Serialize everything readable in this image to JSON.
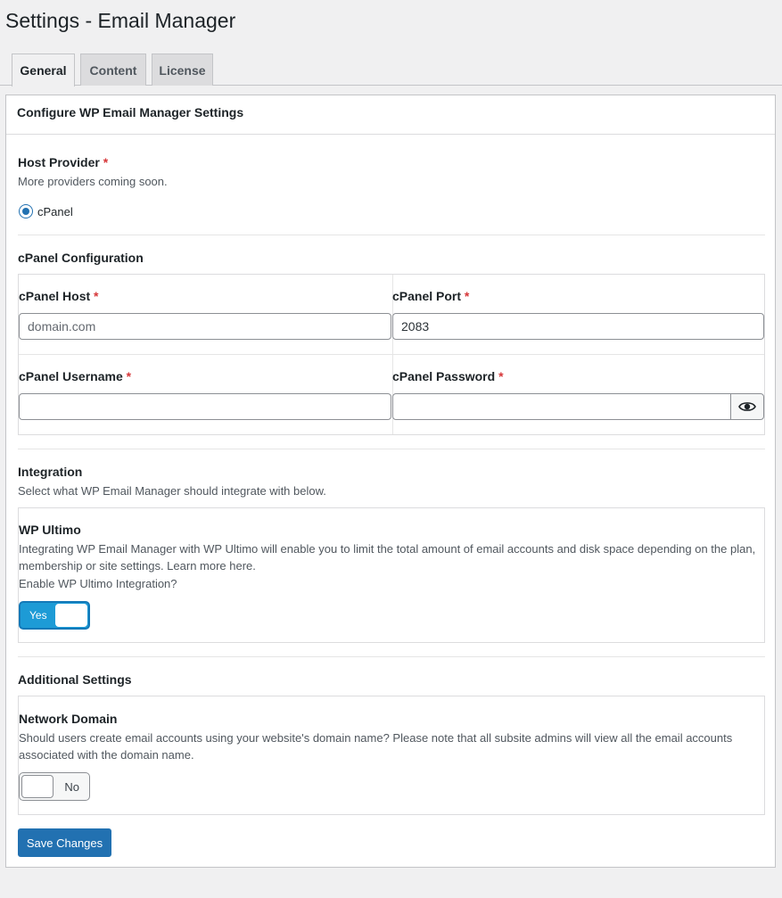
{
  "page": {
    "title": "Settings - Email Manager"
  },
  "tabs": [
    {
      "label": "General",
      "active": true
    },
    {
      "label": "Content",
      "active": false
    },
    {
      "label": "License",
      "active": false
    }
  ],
  "panel": {
    "heading": "Configure WP Email Manager Settings",
    "host_provider": {
      "label": "Host Provider",
      "required_mark": "*",
      "description": "More providers coming soon.",
      "option_label": "cPanel",
      "selected": true
    },
    "cpanel_config": {
      "heading": "cPanel Configuration",
      "host": {
        "label": "cPanel Host",
        "required_mark": "*",
        "placeholder": "domain.com",
        "value": ""
      },
      "port": {
        "label": "cPanel Port",
        "required_mark": "*",
        "value": "2083"
      },
      "username": {
        "label": "cPanel Username",
        "required_mark": "*",
        "value": ""
      },
      "password": {
        "label": "cPanel Password",
        "required_mark": "*",
        "value": ""
      }
    },
    "integration": {
      "heading": "Integration",
      "description": "Select what WP Email Manager should integrate with below.",
      "wp_ultimo": {
        "title": "WP Ultimo",
        "description_line1": "Integrating WP Email Manager with WP Ultimo will enable you to limit the total amount of email accounts and disk space depending on the plan,",
        "description_line2": "membership or site settings. Learn more here.",
        "question": "Enable WP Ultimo Integration?",
        "toggle_label": "Yes",
        "enabled": true
      }
    },
    "additional": {
      "heading": "Additional Settings",
      "network_domain": {
        "title": "Network Domain",
        "description_line1": "Should users create email accounts using your website's domain name? Please note that all subsite admins will view all the email accounts",
        "description_line2": "associated with the domain name.",
        "toggle_label": "No",
        "enabled": false
      }
    },
    "save_label": "Save Changes"
  },
  "colors": {
    "primary": "#2271b1",
    "toggle_on": "#1d9bd6",
    "required": "#d63638"
  }
}
